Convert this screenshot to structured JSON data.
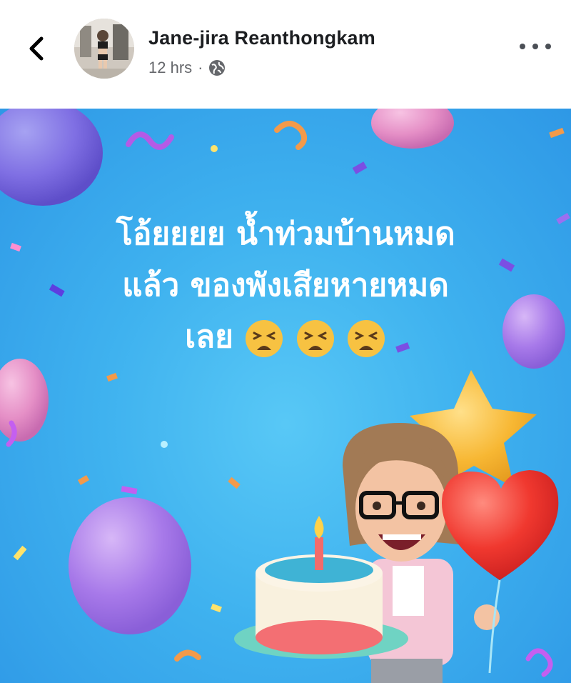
{
  "post": {
    "author_name": "Jane-jira Reanthongkam",
    "time_ago": "12 hrs",
    "separator": "·",
    "audience_icon": "globe-icon",
    "message_text": "โอ้ยยยย น้ำท่วมบ้านหมดแล้ว ของพังเสียหายหมดเลย",
    "message_lines": [
      "โอ้ยยยย น้ำท่วมบ้านหมด",
      "แล้ว ของพังเสียหายหมด",
      "เลย"
    ],
    "emoji_name": "tired-face-emoji",
    "emoji_count": 3,
    "background": "birthday-balloons-confetti",
    "bg_color": "#3fb2ef"
  },
  "icons": {
    "back": "chevron-left-icon",
    "more": "more-options-icon"
  }
}
